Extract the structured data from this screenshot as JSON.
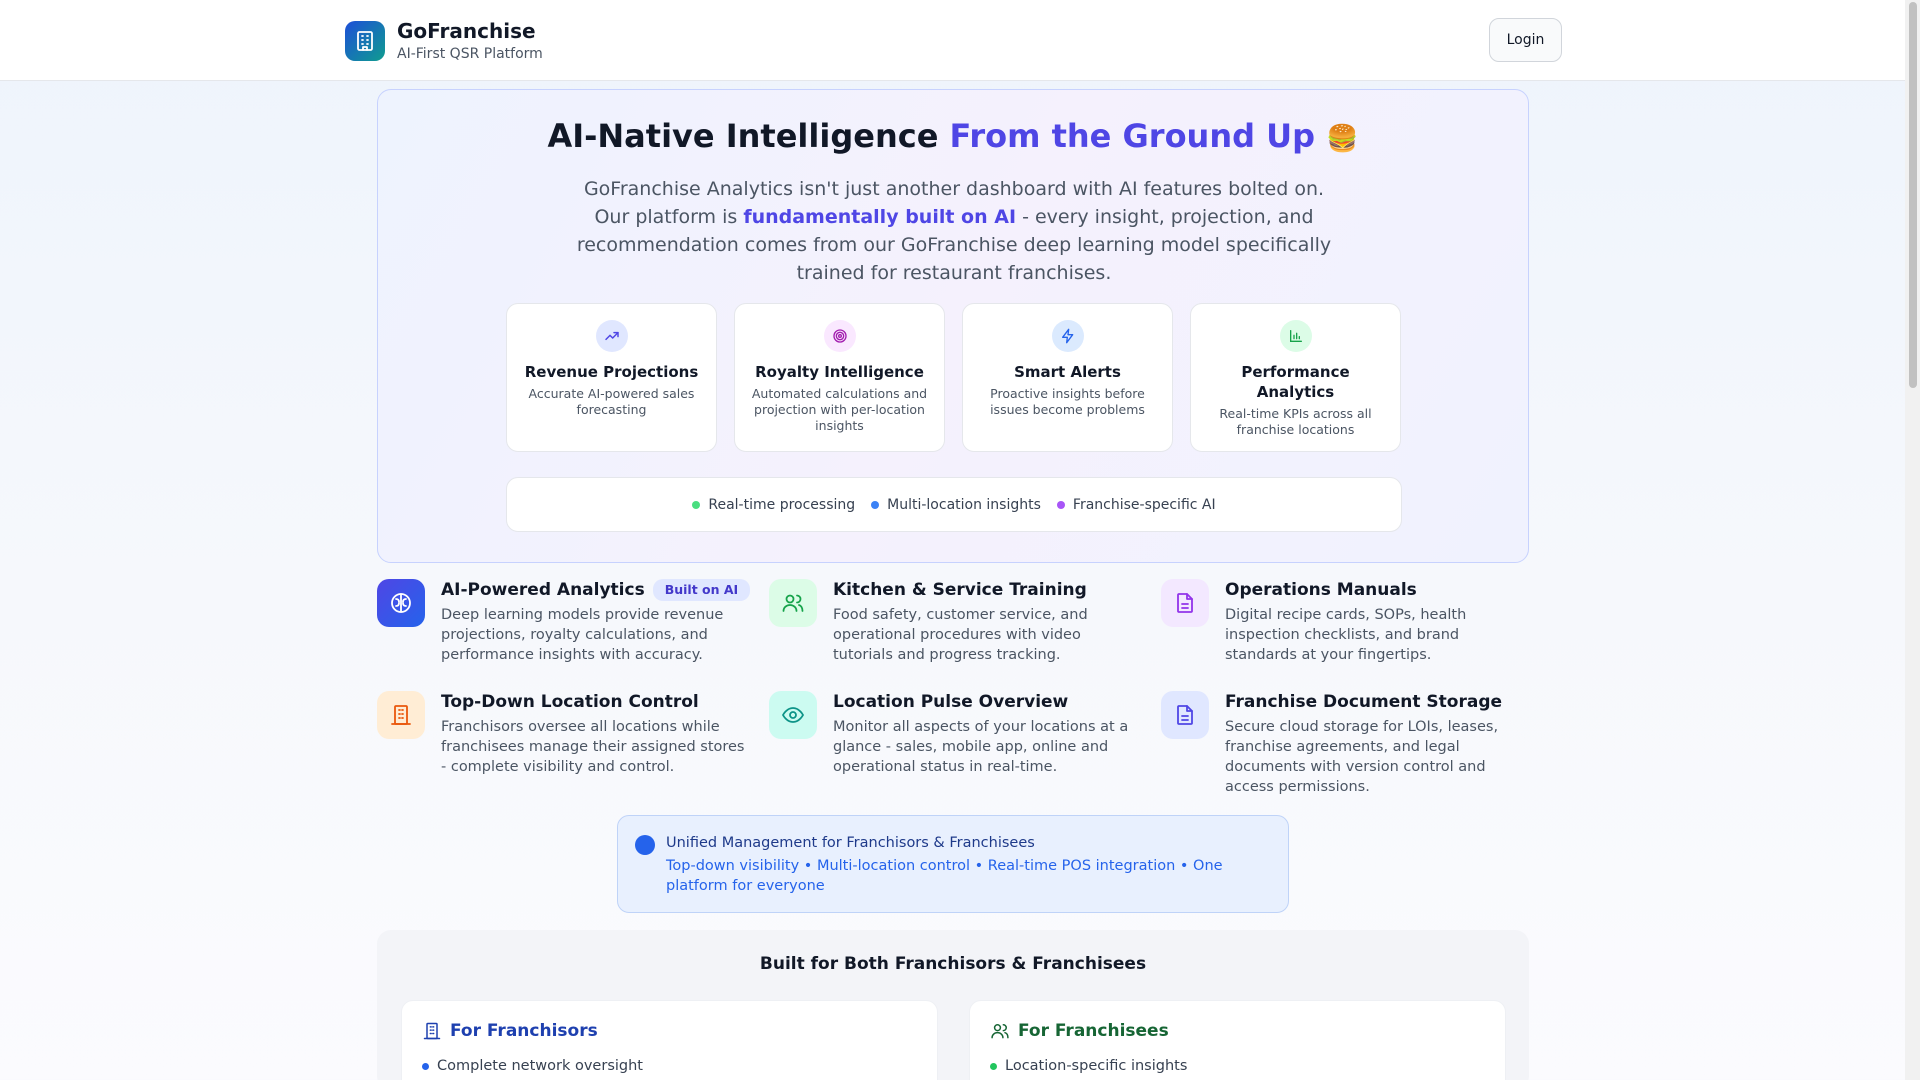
{
  "header": {
    "brand_name": "GoFranchise",
    "brand_tagline": "AI-First QSR Platform",
    "login_label": "Login"
  },
  "hero": {
    "title_main": "AI-Native Intelligence",
    "title_accent": "From the Ground Up",
    "title_emoji": "🍔",
    "desc_before": "GoFranchise Analytics isn't just another dashboard with AI features bolted on. Our platform is",
    "desc_highlight": "fundamentally built on AI",
    "desc_after": "- every insight, projection, and recommendation comes from our GoFranchise deep learning model specifically trained for restaurant franchises.",
    "features": [
      {
        "title": "Revenue Projections",
        "desc": "Accurate AI-powered sales forecasting",
        "icon": "trending-up-icon",
        "color": "#4f46e5"
      },
      {
        "title": "Royalty Intelligence",
        "desc": "Automated calculations and projection with per-location insights",
        "icon": "target-icon",
        "color": "#a21caf"
      },
      {
        "title": "Smart Alerts",
        "desc": "Proactive insights before issues become problems",
        "icon": "zap-icon",
        "color": "#2563eb"
      },
      {
        "title": "Performance Analytics",
        "desc": "Real-time KPIs across all franchise locations",
        "icon": "bar-chart-icon",
        "color": "#16a34a"
      }
    ],
    "chips": [
      {
        "label": "Real-time processing",
        "color": "#4ade80"
      },
      {
        "label": "Multi-location insights",
        "color": "#3b82f6"
      },
      {
        "label": "Franchise-specific AI",
        "color": "#a855f7"
      }
    ]
  },
  "grid": [
    {
      "title": "AI-Powered Analytics",
      "badge": "Built on AI",
      "desc": "Deep learning models provide revenue projections, royalty calculations, and performance insights with accuracy.",
      "icon": "brain-icon"
    },
    {
      "title": "Kitchen & Service Training",
      "desc": "Food safety, customer service, and operational procedures with video tutorials and progress tracking.",
      "icon": "users-icon"
    },
    {
      "title": "Operations Manuals",
      "desc": "Digital recipe cards, SOPs, health inspection checklists, and brand standards at your fingertips.",
      "icon": "file-text-icon"
    },
    {
      "title": "Top-Down Location Control",
      "desc": "Franchisors oversee all locations while franchisees manage their assigned stores - complete visibility and control.",
      "icon": "building-icon"
    },
    {
      "title": "Location Pulse Overview",
      "desc": "Monitor all aspects of your locations at a glance - sales, mobile app, online and operational status in real-time.",
      "icon": "eye-icon"
    },
    {
      "title": "Franchise Document Storage",
      "desc": "Secure cloud storage for LOIs, leases, franchise agreements, and legal documents with version control and access permissions.",
      "icon": "document-icon"
    }
  ],
  "unified": {
    "title": "Unified Management for Franchisors & Franchisees",
    "desc": "Top-down visibility • Multi-location control • Real-time POS integration • One platform for everyone"
  },
  "both": {
    "title": "Built for Both Franchisors & Franchisees",
    "franchisors": {
      "heading": "For Franchisors",
      "first_item": "Complete network oversight",
      "color": "#1e40af"
    },
    "franchisees": {
      "heading": "For Franchisees",
      "first_item": "Location-specific insights",
      "color": "#166534"
    }
  }
}
